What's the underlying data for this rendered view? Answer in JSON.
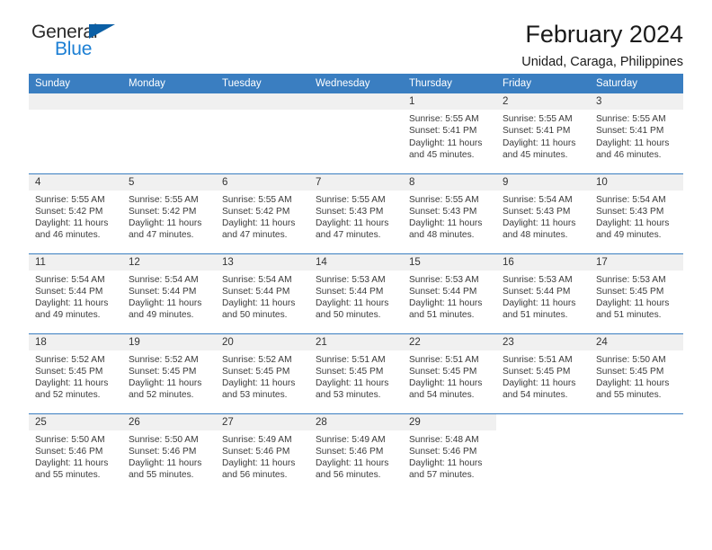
{
  "brand": {
    "name_part1": "General",
    "name_part2": "Blue",
    "accent_color": "#1c7fd4",
    "flag_color": "#0b5fa5"
  },
  "header": {
    "title": "February 2024",
    "subtitle": "Unidad, Caraga, Philippines"
  },
  "theme": {
    "header_row_bg": "#3a7ec1",
    "daynum_bg": "#f0f0f0",
    "row_divider": "#3a7ec1"
  },
  "weekdays": [
    "Sunday",
    "Monday",
    "Tuesday",
    "Wednesday",
    "Thursday",
    "Friday",
    "Saturday"
  ],
  "weeks": [
    [
      {
        "day": "",
        "sunrise": "",
        "sunset": "",
        "daylight_line1": "",
        "daylight_line2": "",
        "empty": true
      },
      {
        "day": "",
        "sunrise": "",
        "sunset": "",
        "daylight_line1": "",
        "daylight_line2": "",
        "empty": true
      },
      {
        "day": "",
        "sunrise": "",
        "sunset": "",
        "daylight_line1": "",
        "daylight_line2": "",
        "empty": true
      },
      {
        "day": "",
        "sunrise": "",
        "sunset": "",
        "daylight_line1": "",
        "daylight_line2": "",
        "empty": true
      },
      {
        "day": "1",
        "sunrise": "Sunrise: 5:55 AM",
        "sunset": "Sunset: 5:41 PM",
        "daylight_line1": "Daylight: 11 hours",
        "daylight_line2": "and 45 minutes.",
        "empty": false
      },
      {
        "day": "2",
        "sunrise": "Sunrise: 5:55 AM",
        "sunset": "Sunset: 5:41 PM",
        "daylight_line1": "Daylight: 11 hours",
        "daylight_line2": "and 45 minutes.",
        "empty": false
      },
      {
        "day": "3",
        "sunrise": "Sunrise: 5:55 AM",
        "sunset": "Sunset: 5:41 PM",
        "daylight_line1": "Daylight: 11 hours",
        "daylight_line2": "and 46 minutes.",
        "empty": false
      }
    ],
    [
      {
        "day": "4",
        "sunrise": "Sunrise: 5:55 AM",
        "sunset": "Sunset: 5:42 PM",
        "daylight_line1": "Daylight: 11 hours",
        "daylight_line2": "and 46 minutes.",
        "empty": false
      },
      {
        "day": "5",
        "sunrise": "Sunrise: 5:55 AM",
        "sunset": "Sunset: 5:42 PM",
        "daylight_line1": "Daylight: 11 hours",
        "daylight_line2": "and 47 minutes.",
        "empty": false
      },
      {
        "day": "6",
        "sunrise": "Sunrise: 5:55 AM",
        "sunset": "Sunset: 5:42 PM",
        "daylight_line1": "Daylight: 11 hours",
        "daylight_line2": "and 47 minutes.",
        "empty": false
      },
      {
        "day": "7",
        "sunrise": "Sunrise: 5:55 AM",
        "sunset": "Sunset: 5:43 PM",
        "daylight_line1": "Daylight: 11 hours",
        "daylight_line2": "and 47 minutes.",
        "empty": false
      },
      {
        "day": "8",
        "sunrise": "Sunrise: 5:55 AM",
        "sunset": "Sunset: 5:43 PM",
        "daylight_line1": "Daylight: 11 hours",
        "daylight_line2": "and 48 minutes.",
        "empty": false
      },
      {
        "day": "9",
        "sunrise": "Sunrise: 5:54 AM",
        "sunset": "Sunset: 5:43 PM",
        "daylight_line1": "Daylight: 11 hours",
        "daylight_line2": "and 48 minutes.",
        "empty": false
      },
      {
        "day": "10",
        "sunrise": "Sunrise: 5:54 AM",
        "sunset": "Sunset: 5:43 PM",
        "daylight_line1": "Daylight: 11 hours",
        "daylight_line2": "and 49 minutes.",
        "empty": false
      }
    ],
    [
      {
        "day": "11",
        "sunrise": "Sunrise: 5:54 AM",
        "sunset": "Sunset: 5:44 PM",
        "daylight_line1": "Daylight: 11 hours",
        "daylight_line2": "and 49 minutes.",
        "empty": false
      },
      {
        "day": "12",
        "sunrise": "Sunrise: 5:54 AM",
        "sunset": "Sunset: 5:44 PM",
        "daylight_line1": "Daylight: 11 hours",
        "daylight_line2": "and 49 minutes.",
        "empty": false
      },
      {
        "day": "13",
        "sunrise": "Sunrise: 5:54 AM",
        "sunset": "Sunset: 5:44 PM",
        "daylight_line1": "Daylight: 11 hours",
        "daylight_line2": "and 50 minutes.",
        "empty": false
      },
      {
        "day": "14",
        "sunrise": "Sunrise: 5:53 AM",
        "sunset": "Sunset: 5:44 PM",
        "daylight_line1": "Daylight: 11 hours",
        "daylight_line2": "and 50 minutes.",
        "empty": false
      },
      {
        "day": "15",
        "sunrise": "Sunrise: 5:53 AM",
        "sunset": "Sunset: 5:44 PM",
        "daylight_line1": "Daylight: 11 hours",
        "daylight_line2": "and 51 minutes.",
        "empty": false
      },
      {
        "day": "16",
        "sunrise": "Sunrise: 5:53 AM",
        "sunset": "Sunset: 5:44 PM",
        "daylight_line1": "Daylight: 11 hours",
        "daylight_line2": "and 51 minutes.",
        "empty": false
      },
      {
        "day": "17",
        "sunrise": "Sunrise: 5:53 AM",
        "sunset": "Sunset: 5:45 PM",
        "daylight_line1": "Daylight: 11 hours",
        "daylight_line2": "and 51 minutes.",
        "empty": false
      }
    ],
    [
      {
        "day": "18",
        "sunrise": "Sunrise: 5:52 AM",
        "sunset": "Sunset: 5:45 PM",
        "daylight_line1": "Daylight: 11 hours",
        "daylight_line2": "and 52 minutes.",
        "empty": false
      },
      {
        "day": "19",
        "sunrise": "Sunrise: 5:52 AM",
        "sunset": "Sunset: 5:45 PM",
        "daylight_line1": "Daylight: 11 hours",
        "daylight_line2": "and 52 minutes.",
        "empty": false
      },
      {
        "day": "20",
        "sunrise": "Sunrise: 5:52 AM",
        "sunset": "Sunset: 5:45 PM",
        "daylight_line1": "Daylight: 11 hours",
        "daylight_line2": "and 53 minutes.",
        "empty": false
      },
      {
        "day": "21",
        "sunrise": "Sunrise: 5:51 AM",
        "sunset": "Sunset: 5:45 PM",
        "daylight_line1": "Daylight: 11 hours",
        "daylight_line2": "and 53 minutes.",
        "empty": false
      },
      {
        "day": "22",
        "sunrise": "Sunrise: 5:51 AM",
        "sunset": "Sunset: 5:45 PM",
        "daylight_line1": "Daylight: 11 hours",
        "daylight_line2": "and 54 minutes.",
        "empty": false
      },
      {
        "day": "23",
        "sunrise": "Sunrise: 5:51 AM",
        "sunset": "Sunset: 5:45 PM",
        "daylight_line1": "Daylight: 11 hours",
        "daylight_line2": "and 54 minutes.",
        "empty": false
      },
      {
        "day": "24",
        "sunrise": "Sunrise: 5:50 AM",
        "sunset": "Sunset: 5:45 PM",
        "daylight_line1": "Daylight: 11 hours",
        "daylight_line2": "and 55 minutes.",
        "empty": false
      }
    ],
    [
      {
        "day": "25",
        "sunrise": "Sunrise: 5:50 AM",
        "sunset": "Sunset: 5:46 PM",
        "daylight_line1": "Daylight: 11 hours",
        "daylight_line2": "and 55 minutes.",
        "empty": false
      },
      {
        "day": "26",
        "sunrise": "Sunrise: 5:50 AM",
        "sunset": "Sunset: 5:46 PM",
        "daylight_line1": "Daylight: 11 hours",
        "daylight_line2": "and 55 minutes.",
        "empty": false
      },
      {
        "day": "27",
        "sunrise": "Sunrise: 5:49 AM",
        "sunset": "Sunset: 5:46 PM",
        "daylight_line1": "Daylight: 11 hours",
        "daylight_line2": "and 56 minutes.",
        "empty": false
      },
      {
        "day": "28",
        "sunrise": "Sunrise: 5:49 AM",
        "sunset": "Sunset: 5:46 PM",
        "daylight_line1": "Daylight: 11 hours",
        "daylight_line2": "and 56 minutes.",
        "empty": false
      },
      {
        "day": "29",
        "sunrise": "Sunrise: 5:48 AM",
        "sunset": "Sunset: 5:46 PM",
        "daylight_line1": "Daylight: 11 hours",
        "daylight_line2": "and 57 minutes.",
        "empty": false
      },
      {
        "day": "",
        "sunrise": "",
        "sunset": "",
        "daylight_line1": "",
        "daylight_line2": "",
        "empty": true,
        "nocell": true
      },
      {
        "day": "",
        "sunrise": "",
        "sunset": "",
        "daylight_line1": "",
        "daylight_line2": "",
        "empty": true,
        "nocell": true
      }
    ]
  ]
}
